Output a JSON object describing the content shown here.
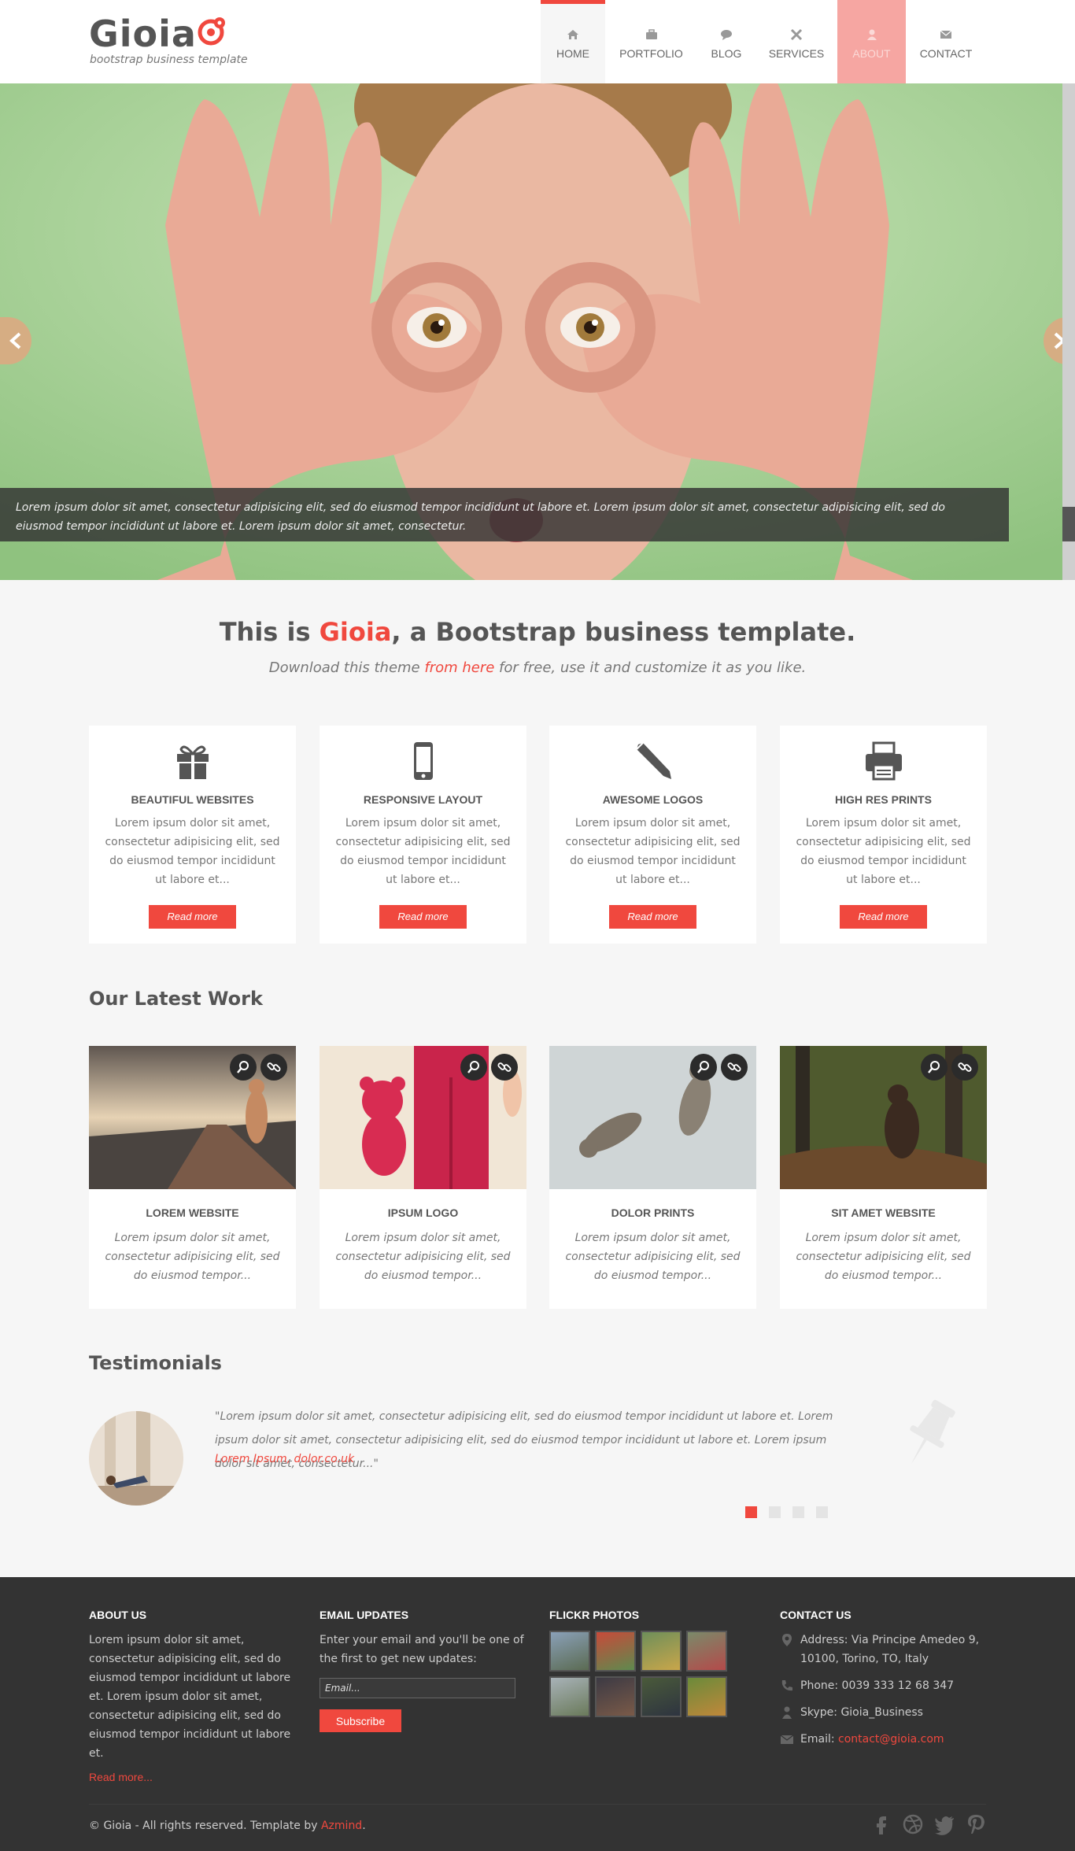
{
  "header": {
    "logo_title": "Gioia",
    "logo_subtitle": "bootstrap business template",
    "nav": [
      {
        "label": "HOME",
        "icon": "home-icon"
      },
      {
        "label": "PORTFOLIO",
        "icon": "briefcase-icon"
      },
      {
        "label": "BLOG",
        "icon": "comment-icon"
      },
      {
        "label": "SERVICES",
        "icon": "tools-icon"
      },
      {
        "label": "ABOUT",
        "icon": "user-icon"
      },
      {
        "label": "CONTACT",
        "icon": "envelope-icon"
      }
    ]
  },
  "slider": {
    "caption": "Lorem ipsum dolor sit amet, consectetur adipisicing elit, sed do eiusmod tempor incididunt ut labore et. Lorem ipsum dolor sit amet, consectetur adipisicing elit, sed do eiusmod tempor incididunt ut labore et. Lorem ipsum dolor sit amet, consectetur."
  },
  "intro": {
    "title_before": "This is ",
    "title_brand": "Gioia",
    "title_after": ", a Bootstrap business template.",
    "sub_before": "Download this theme ",
    "sub_link": "from here",
    "sub_after": " for free, use it and customize it as you like."
  },
  "features": [
    {
      "icon": "gift-icon",
      "title": "BEAUTIFUL WEBSITES",
      "text": "Lorem ipsum dolor sit amet, consectetur adipisicing elit, sed do eiusmod tempor incididunt ut labore et...",
      "button": "Read more"
    },
    {
      "icon": "mobile-phone-icon",
      "title": "RESPONSIVE LAYOUT",
      "text": "Lorem ipsum dolor sit amet, consectetur adipisicing elit, sed do eiusmod tempor incididunt ut labore et...",
      "button": "Read more"
    },
    {
      "icon": "pencil-icon",
      "title": "AWESOME LOGOS",
      "text": "Lorem ipsum dolor sit amet, consectetur adipisicing elit, sed do eiusmod tempor incididunt ut labore et...",
      "button": "Read more"
    },
    {
      "icon": "printer-icon",
      "title": "HIGH RES PRINTS",
      "text": "Lorem ipsum dolor sit amet, consectetur adipisicing elit, sed do eiusmod tempor incididunt ut labore et...",
      "button": "Read more"
    }
  ],
  "latest_work": {
    "title": "Our Latest Work",
    "items": [
      {
        "title": "LOREM WEBSITE",
        "text": "Lorem ipsum dolor sit amet, consectetur adipisicing elit, sed do eiusmod tempor..."
      },
      {
        "title": "IPSUM LOGO",
        "text": "Lorem ipsum dolor sit amet, consectetur adipisicing elit, sed do eiusmod tempor..."
      },
      {
        "title": "DOLOR PRINTS",
        "text": "Lorem ipsum dolor sit amet, consectetur adipisicing elit, sed do eiusmod tempor..."
      },
      {
        "title": "SIT AMET WEBSITE",
        "text": "Lorem ipsum dolor sit amet, consectetur adipisicing elit, sed do eiusmod tempor..."
      }
    ]
  },
  "testimonials": {
    "title": "Testimonials",
    "quote": "\"Lorem ipsum dolor sit amet, consectetur adipisicing elit, sed do eiusmod tempor incididunt ut labore et. Lorem ipsum dolor sit amet, consectetur adipisicing elit, sed do eiusmod tempor incididunt ut labore et. Lorem ipsum dolor sit amet, consectetur...\"",
    "author": "Lorem Ipsum, dolor.co.uk",
    "dots": 4,
    "active_dot": 1
  },
  "footer": {
    "about_title": "ABOUT US",
    "about_text": "Lorem ipsum dolor sit amet, consectetur adipisicing elit, sed do eiusmod tempor incididunt ut labore et. Lorem ipsum dolor sit amet, consectetur adipisicing elit, sed do eiusmod tempor incididunt ut labore et.",
    "about_more": "Read more...",
    "email_title": "EMAIL UPDATES",
    "email_text": "Enter your email and you'll be one of the first to get new updates:",
    "email_placeholder": "Email...",
    "subscribe": "Subscribe",
    "flickr_title": "FLICKR PHOTOS",
    "contact_title": "CONTACT US",
    "address": "Address: Via Principe Amedeo 9, 10100, Torino, TO, Italy",
    "phone": "Phone: 0039 333 12 68 347",
    "skype": "Skype: Gioia_Business",
    "email_label": "Email: ",
    "email_value": "contact@gioia.com",
    "copyright_before": "© Gioia - All rights reserved. Template by ",
    "copyright_link": "Azmind",
    "copyright_after": ".",
    "socials": [
      "facebook-icon",
      "dribbble-icon",
      "twitter-icon",
      "pinterest-icon"
    ]
  },
  "colors": {
    "accent": "#f0483e",
    "dark": "#333333",
    "background": "#f6f6f6"
  }
}
